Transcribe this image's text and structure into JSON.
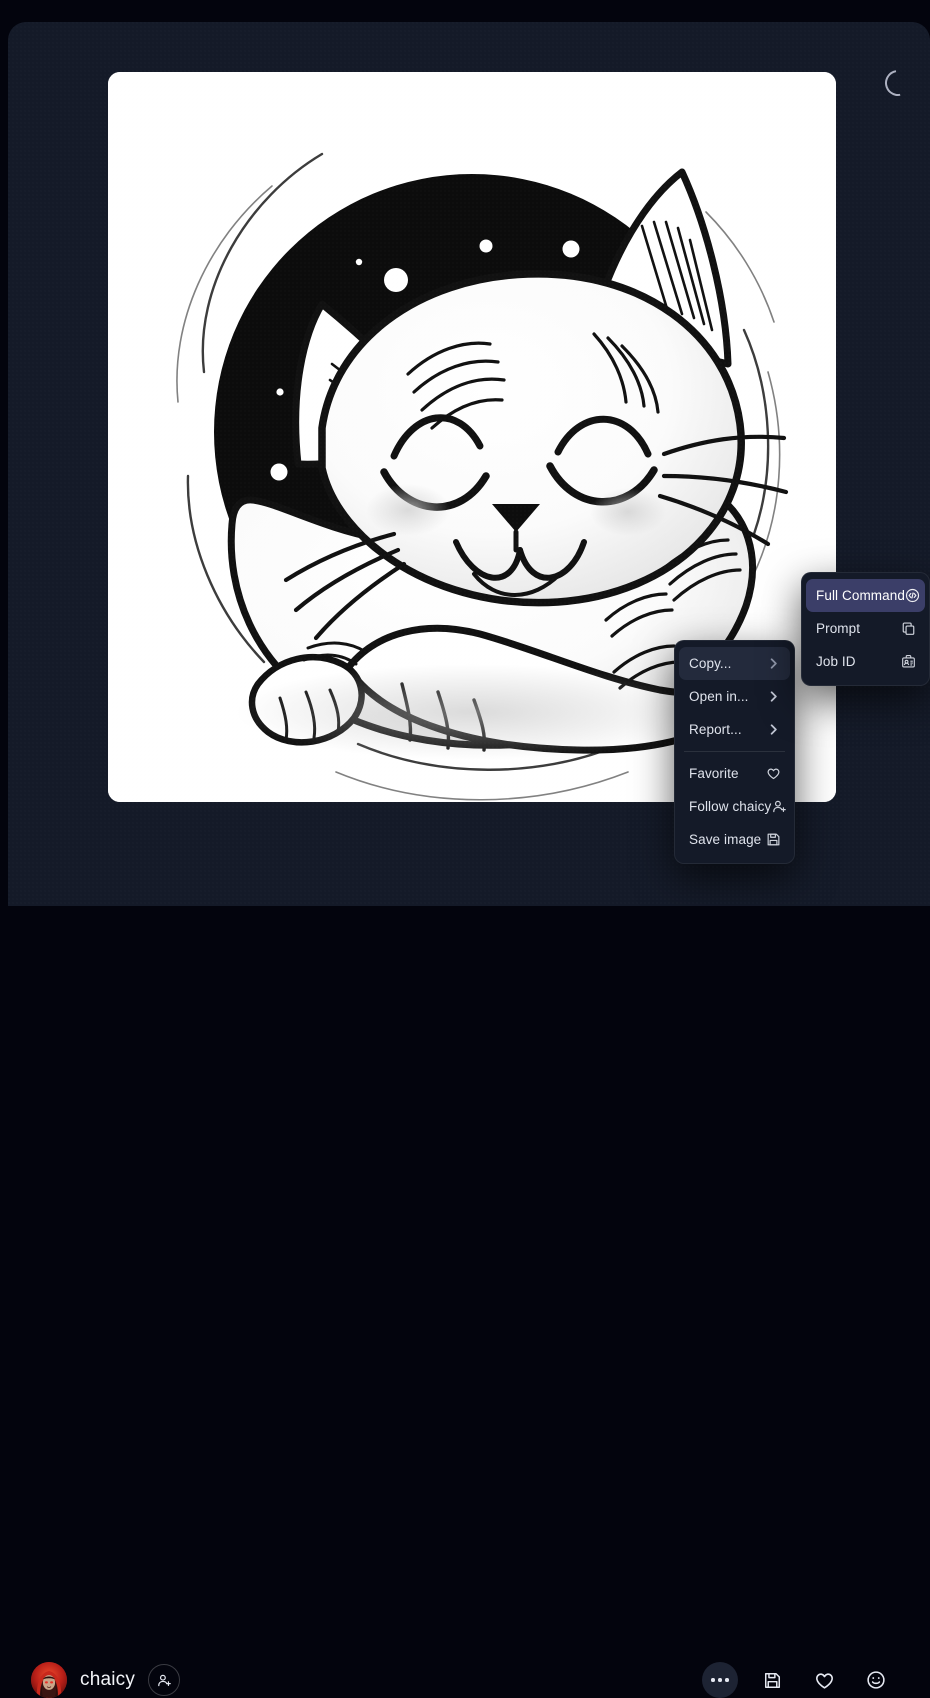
{
  "theme": {
    "outer_bg": "#03040d",
    "panel_bg": "#141a28",
    "menu_bg": "#141a28",
    "menu_hover_bg": "#232a3c",
    "submenu_accent_bg": "#3b3e68",
    "text": "#dfe3ec",
    "card_bg": "#ffffff"
  },
  "status": {
    "spinner": "loading-spinner",
    "spinner_visible": true
  },
  "artwork": {
    "name": "sleeping-cat-illustration",
    "description": "Black and white line art of a sleeping cat curled up inside a circle with a starry night sky background",
    "alt": "sleeping cat in a starry circle"
  },
  "context_menu": {
    "name": "image-context-menu",
    "items": [
      {
        "label": "Copy...",
        "icon": "chevron-right-icon",
        "highlighted": true,
        "submenu": true
      },
      {
        "label": "Open in...",
        "icon": "chevron-right-icon",
        "highlighted": false,
        "submenu": true
      },
      {
        "label": "Report...",
        "icon": "chevron-right-icon",
        "highlighted": false,
        "submenu": true
      },
      {
        "label": "Favorite",
        "icon": "heart-icon",
        "highlighted": false,
        "submenu": false
      },
      {
        "label": "Follow chaicy",
        "icon": "user-plus-icon",
        "highlighted": false,
        "submenu": false
      },
      {
        "label": "Save image",
        "icon": "floppy-disk-icon",
        "highlighted": false,
        "submenu": false
      }
    ],
    "divider_after_index": 2
  },
  "submenu": {
    "name": "copy-submenu",
    "items": [
      {
        "label": "Full Command",
        "icon": "code-circle-icon",
        "highlighted": true
      },
      {
        "label": "Prompt",
        "icon": "copy-icon",
        "highlighted": false
      },
      {
        "label": "Job ID",
        "icon": "id-badge-icon",
        "highlighted": false
      }
    ]
  },
  "footer": {
    "author": {
      "username": "chaicy",
      "avatar": "red-hooded-character-avatar",
      "follow_icon": "user-plus-icon"
    },
    "actions": [
      {
        "name": "more-options-button",
        "icon": "ellipsis-icon",
        "active": true
      },
      {
        "name": "save-image-button",
        "icon": "floppy-disk-icon",
        "active": false
      },
      {
        "name": "favorite-button",
        "icon": "heart-icon",
        "active": false
      },
      {
        "name": "reaction-button",
        "icon": "smiley-face-icon",
        "active": false
      }
    ]
  }
}
